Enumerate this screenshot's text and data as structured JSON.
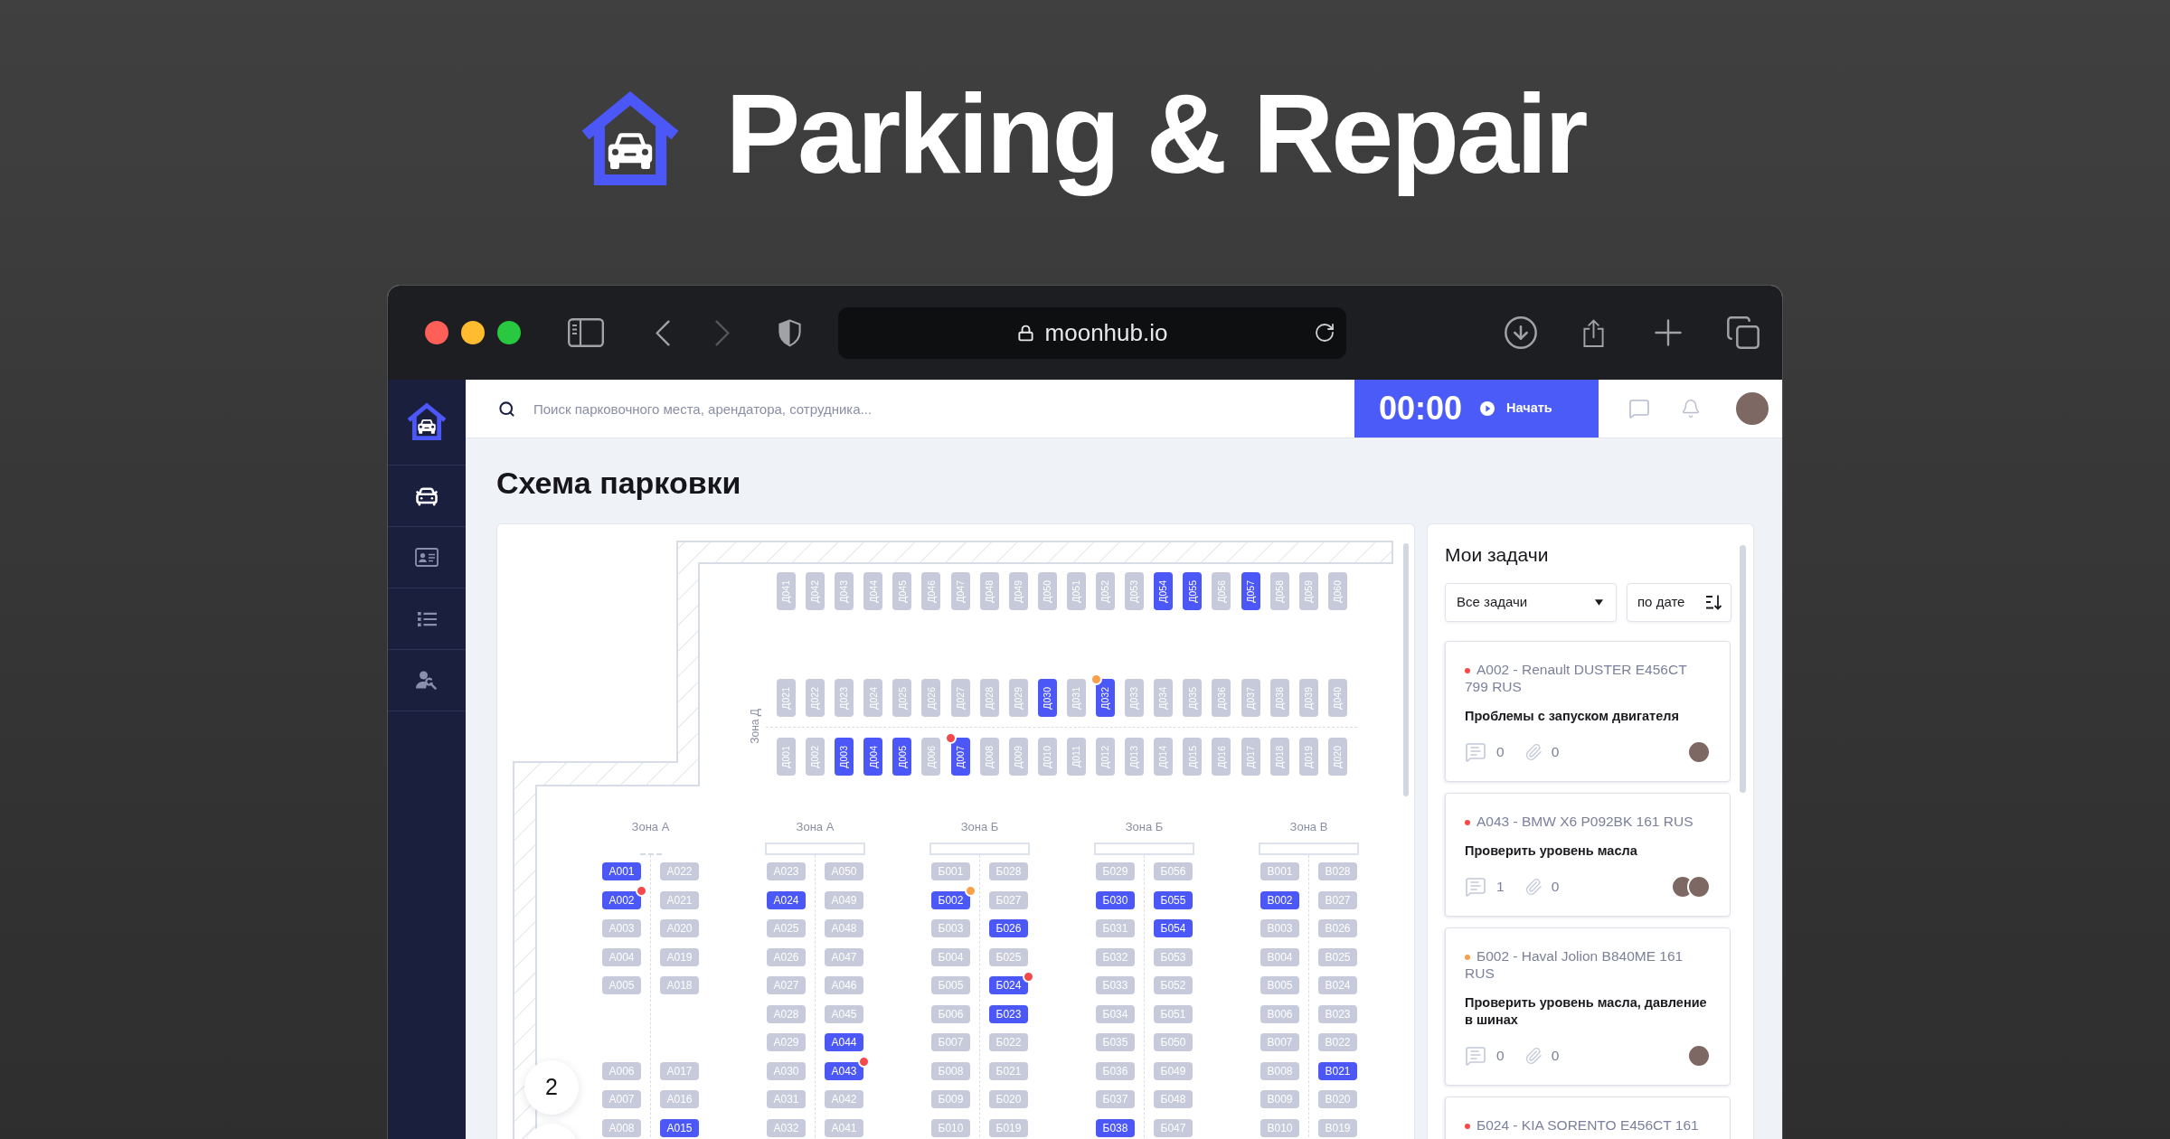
{
  "header": {
    "title": "Parking & Repair"
  },
  "browser": {
    "url": "moonhub.io"
  },
  "sidebar": {
    "items": [
      {
        "selected": true
      },
      {
        "selected": false
      },
      {
        "selected": false
      },
      {
        "selected": false
      }
    ]
  },
  "top_bar": {
    "search": {
      "placeholder": "Поиск парковочного места, арендатора, сотрудника..."
    },
    "timer": {
      "time": "00:00",
      "button": "Начать"
    },
    "avatar": {
      "kind": "photo"
    }
  },
  "page": {
    "title": "Схема парковки"
  },
  "map": {
    "zone_d": {
      "label": "Зона Д",
      "rows": [
        [
          {
            "label": "Д041",
            "occupied": false
          },
          {
            "label": "Д042",
            "occupied": false
          },
          {
            "label": "Д043",
            "occupied": false
          },
          {
            "label": "Д044",
            "occupied": false
          },
          {
            "label": "Д045",
            "occupied": false
          },
          {
            "label": "Д046",
            "occupied": false
          },
          {
            "label": "Д047",
            "occupied": false
          },
          {
            "label": "Д048",
            "occupied": false
          },
          {
            "label": "Д049",
            "occupied": false
          },
          {
            "label": "Д050",
            "occupied": false
          },
          {
            "label": "Д051",
            "occupied": false
          },
          {
            "label": "Д052",
            "occupied": false
          },
          {
            "label": "Д053",
            "occupied": false
          },
          {
            "label": "Д054",
            "occupied": true
          },
          {
            "label": "Д055",
            "occupied": true
          },
          {
            "label": "Д056",
            "occupied": false
          },
          {
            "label": "Д057",
            "occupied": true
          },
          {
            "label": "Д058",
            "occupied": false
          },
          {
            "label": "Д059",
            "occupied": false
          },
          {
            "label": "Д060",
            "occupied": false
          }
        ],
        [
          {
            "label": "Д021",
            "occupied": false
          },
          {
            "label": "Д022",
            "occupied": false
          },
          {
            "label": "Д023",
            "occupied": false
          },
          {
            "label": "Д024",
            "occupied": false
          },
          {
            "label": "Д025",
            "occupied": false
          },
          {
            "label": "Д026",
            "occupied": false
          },
          {
            "label": "Д027",
            "occupied": false
          },
          {
            "label": "Д028",
            "occupied": false
          },
          {
            "label": "Д029",
            "occupied": false
          },
          {
            "label": "Д030",
            "occupied": true
          },
          {
            "label": "Д031",
            "occupied": false
          },
          {
            "label": "Д032",
            "occupied": true,
            "color": "#f7a24a"
          },
          {
            "label": "Д033",
            "occupied": false
          },
          {
            "label": "Д034",
            "occupied": false
          },
          {
            "label": "Д035",
            "occupied": false
          },
          {
            "label": "Д036",
            "occupied": false
          },
          {
            "label": "Д037",
            "occupied": false
          },
          {
            "label": "Д038",
            "occupied": false
          },
          {
            "label": "Д039",
            "occupied": false
          },
          {
            "label": "Д040",
            "occupied": false
          }
        ],
        [
          {
            "label": "Д001",
            "occupied": false
          },
          {
            "label": "Д002",
            "occupied": false
          },
          {
            "label": "Д003",
            "occupied": true
          },
          {
            "label": "Д004",
            "occupied": true
          },
          {
            "label": "Д005",
            "occupied": true
          },
          {
            "label": "Д006",
            "occupied": false
          },
          {
            "label": "Д007",
            "occupied": true,
            "color": "#f5484a"
          },
          {
            "label": "Д008",
            "occupied": false
          },
          {
            "label": "Д009",
            "occupied": false
          },
          {
            "label": "Д010",
            "occupied": false
          },
          {
            "label": "Д011",
            "occupied": false
          },
          {
            "label": "Д012",
            "occupied": false
          },
          {
            "label": "Д013",
            "occupied": false
          },
          {
            "label": "Д014",
            "occupied": false
          },
          {
            "label": "Д015",
            "occupied": false
          },
          {
            "label": "Д016",
            "occupied": false
          },
          {
            "label": "Д017",
            "occupied": false
          },
          {
            "label": "Д018",
            "occupied": false
          },
          {
            "label": "Д019",
            "occupied": false
          },
          {
            "label": "Д020",
            "occupied": false
          }
        ]
      ]
    },
    "zones": [
      {
        "label": "Зона А",
        "barrier": false,
        "blocks": [
          [
            [
              {
                "label": "А001",
                "occupied": true
              },
              {
                "label": "А022",
                "occupied": false
              }
            ],
            [
              {
                "label": "А002",
                "occupied": true,
                "color": "#f5484a"
              },
              {
                "label": "А021",
                "occupied": false
              }
            ],
            [
              {
                "label": "А003",
                "occupied": false
              },
              {
                "label": "А020",
                "occupied": false
              }
            ],
            [
              {
                "label": "А004",
                "occupied": false
              },
              {
                "label": "А019",
                "occupied": false
              }
            ],
            [
              {
                "label": "А005",
                "occupied": false
              },
              {
                "label": "А018",
                "occupied": false
              }
            ]
          ],
          [
            [
              {
                "label": "А006",
                "occupied": false
              },
              {
                "label": "А017",
                "occupied": false
              }
            ],
            [
              {
                "label": "А007",
                "occupied": false
              },
              {
                "label": "А016",
                "occupied": false
              }
            ],
            [
              {
                "label": "А008",
                "occupied": false
              },
              {
                "label": "А015",
                "occupied": true
              }
            ]
          ]
        ]
      },
      {
        "label": "Зона А",
        "barrier": true,
        "blocks": [
          [
            [
              {
                "label": "А023",
                "occupied": false
              },
              {
                "label": "А050",
                "occupied": false
              }
            ],
            [
              {
                "label": "А024",
                "occupied": true
              },
              {
                "label": "А049",
                "occupied": false
              }
            ],
            [
              {
                "label": "А025",
                "occupied": false
              },
              {
                "label": "А048",
                "occupied": false
              }
            ],
            [
              {
                "label": "А026",
                "occupied": false
              },
              {
                "label": "А047",
                "occupied": false
              }
            ],
            [
              {
                "label": "А027",
                "occupied": false
              },
              {
                "label": "А046",
                "occupied": false
              }
            ],
            [
              {
                "label": "А028",
                "occupied": false
              },
              {
                "label": "А045",
                "occupied": false
              }
            ],
            [
              {
                "label": "А029",
                "occupied": false
              },
              {
                "label": "А044",
                "occupied": true
              }
            ],
            [
              {
                "label": "А030",
                "occupied": false
              },
              {
                "label": "А043",
                "occupied": true,
                "color": "#f5484a"
              }
            ],
            [
              {
                "label": "А031",
                "occupied": false
              },
              {
                "label": "А042",
                "occupied": false
              }
            ],
            [
              {
                "label": "А032",
                "occupied": false
              },
              {
                "label": "А041",
                "occupied": false
              }
            ]
          ]
        ]
      },
      {
        "label": "Зона Б",
        "barrier": true,
        "blocks": [
          [
            [
              {
                "label": "Б001",
                "occupied": false
              },
              {
                "label": "Б028",
                "occupied": false
              }
            ],
            [
              {
                "label": "Б002",
                "occupied": true,
                "color": "#f7a24a"
              },
              {
                "label": "Б027",
                "occupied": false
              }
            ],
            [
              {
                "label": "Б003",
                "occupied": false
              },
              {
                "label": "Б026",
                "occupied": true
              }
            ],
            [
              {
                "label": "Б004",
                "occupied": false
              },
              {
                "label": "Б025",
                "occupied": false
              }
            ],
            [
              {
                "label": "Б005",
                "occupied": false
              },
              {
                "label": "Б024",
                "occupied": true,
                "color": "#f5484a"
              }
            ],
            [
              {
                "label": "Б006",
                "occupied": false
              },
              {
                "label": "Б023",
                "occupied": true
              }
            ],
            [
              {
                "label": "Б007",
                "occupied": false
              },
              {
                "label": "Б022",
                "occupied": false
              }
            ],
            [
              {
                "label": "Б008",
                "occupied": false
              },
              {
                "label": "Б021",
                "occupied": false
              }
            ],
            [
              {
                "label": "Б009",
                "occupied": false
              },
              {
                "label": "Б020",
                "occupied": false
              }
            ],
            [
              {
                "label": "Б010",
                "occupied": false
              },
              {
                "label": "Б019",
                "occupied": false
              }
            ]
          ]
        ]
      },
      {
        "label": "Зона Б",
        "barrier": true,
        "blocks": [
          [
            [
              {
                "label": "Б029",
                "occupied": false
              },
              {
                "label": "Б056",
                "occupied": false
              }
            ],
            [
              {
                "label": "Б030",
                "occupied": true
              },
              {
                "label": "Б055",
                "occupied": true
              }
            ],
            [
              {
                "label": "Б031",
                "occupied": false
              },
              {
                "label": "Б054",
                "occupied": true
              }
            ],
            [
              {
                "label": "Б032",
                "occupied": false
              },
              {
                "label": "Б053",
                "occupied": false
              }
            ],
            [
              {
                "label": "Б033",
                "occupied": false
              },
              {
                "label": "Б052",
                "occupied": false
              }
            ],
            [
              {
                "label": "Б034",
                "occupied": false
              },
              {
                "label": "Б051",
                "occupied": false
              }
            ],
            [
              {
                "label": "Б035",
                "occupied": false
              },
              {
                "label": "Б050",
                "occupied": false
              }
            ],
            [
              {
                "label": "Б036",
                "occupied": false
              },
              {
                "label": "Б049",
                "occupied": false
              }
            ],
            [
              {
                "label": "Б037",
                "occupied": false
              },
              {
                "label": "Б048",
                "occupied": false
              }
            ],
            [
              {
                "label": "Б038",
                "occupied": true
              },
              {
                "label": "Б047",
                "occupied": false
              }
            ]
          ]
        ]
      },
      {
        "label": "Зона В",
        "barrier": true,
        "blocks": [
          [
            [
              {
                "label": "В001",
                "occupied": false
              },
              {
                "label": "В028",
                "occupied": false
              }
            ],
            [
              {
                "label": "В002",
                "occupied": true
              },
              {
                "label": "В027",
                "occupied": false
              }
            ],
            [
              {
                "label": "В003",
                "occupied": false
              },
              {
                "label": "В026",
                "occupied": false
              }
            ],
            [
              {
                "label": "В004",
                "occupied": false
              },
              {
                "label": "В025",
                "occupied": false
              }
            ],
            [
              {
                "label": "В005",
                "occupied": false
              },
              {
                "label": "В024",
                "occupied": false
              }
            ],
            [
              {
                "label": "В006",
                "occupied": false
              },
              {
                "label": "В023",
                "occupied": false
              }
            ],
            [
              {
                "label": "В007",
                "occupied": false
              },
              {
                "label": "В022",
                "occupied": false
              }
            ],
            [
              {
                "label": "В008",
                "occupied": false
              },
              {
                "label": "В021",
                "occupied": true
              }
            ],
            [
              {
                "label": "В009",
                "occupied": false
              },
              {
                "label": "В020",
                "occupied": false
              }
            ],
            [
              {
                "label": "В010",
                "occupied": false
              },
              {
                "label": "В019",
                "occupied": false
              }
            ]
          ]
        ]
      }
    ],
    "floor_buttons": [
      {
        "label": "2"
      }
    ]
  },
  "tasks": {
    "title": "Мои задачи",
    "filter": "Все задачи",
    "sort": "по дате",
    "items": [
      {
        "color": "#f5484a",
        "title": "А002 - Renault DUSTER E456CT 799 RUS",
        "description": "Проблемы с запуском двигателя",
        "comments": "0",
        "attachments": "0",
        "assignees": [
          {
            "kind": "photo"
          }
        ]
      },
      {
        "color": "#f5484a",
        "title": "А043 - BMW X6 P092BK 161 RUS",
        "description": "Проверить уровень масла",
        "comments": "1",
        "attachments": "0",
        "assignees": [
          {
            "kind": "photo"
          },
          {
            "kind": "photo"
          }
        ]
      },
      {
        "color": "#f7a24a",
        "title": "Б002 - Haval Jolion B840ME 161 RUS",
        "description": "Проверить уровень масла, давление в шинах",
        "comments": "0",
        "attachments": "0",
        "assignees": [
          {
            "kind": "photo"
          }
        ]
      },
      {
        "color": "#f5484a",
        "title": "Б024 - KIA SORENTO E456CT 161"
      }
    ]
  }
}
